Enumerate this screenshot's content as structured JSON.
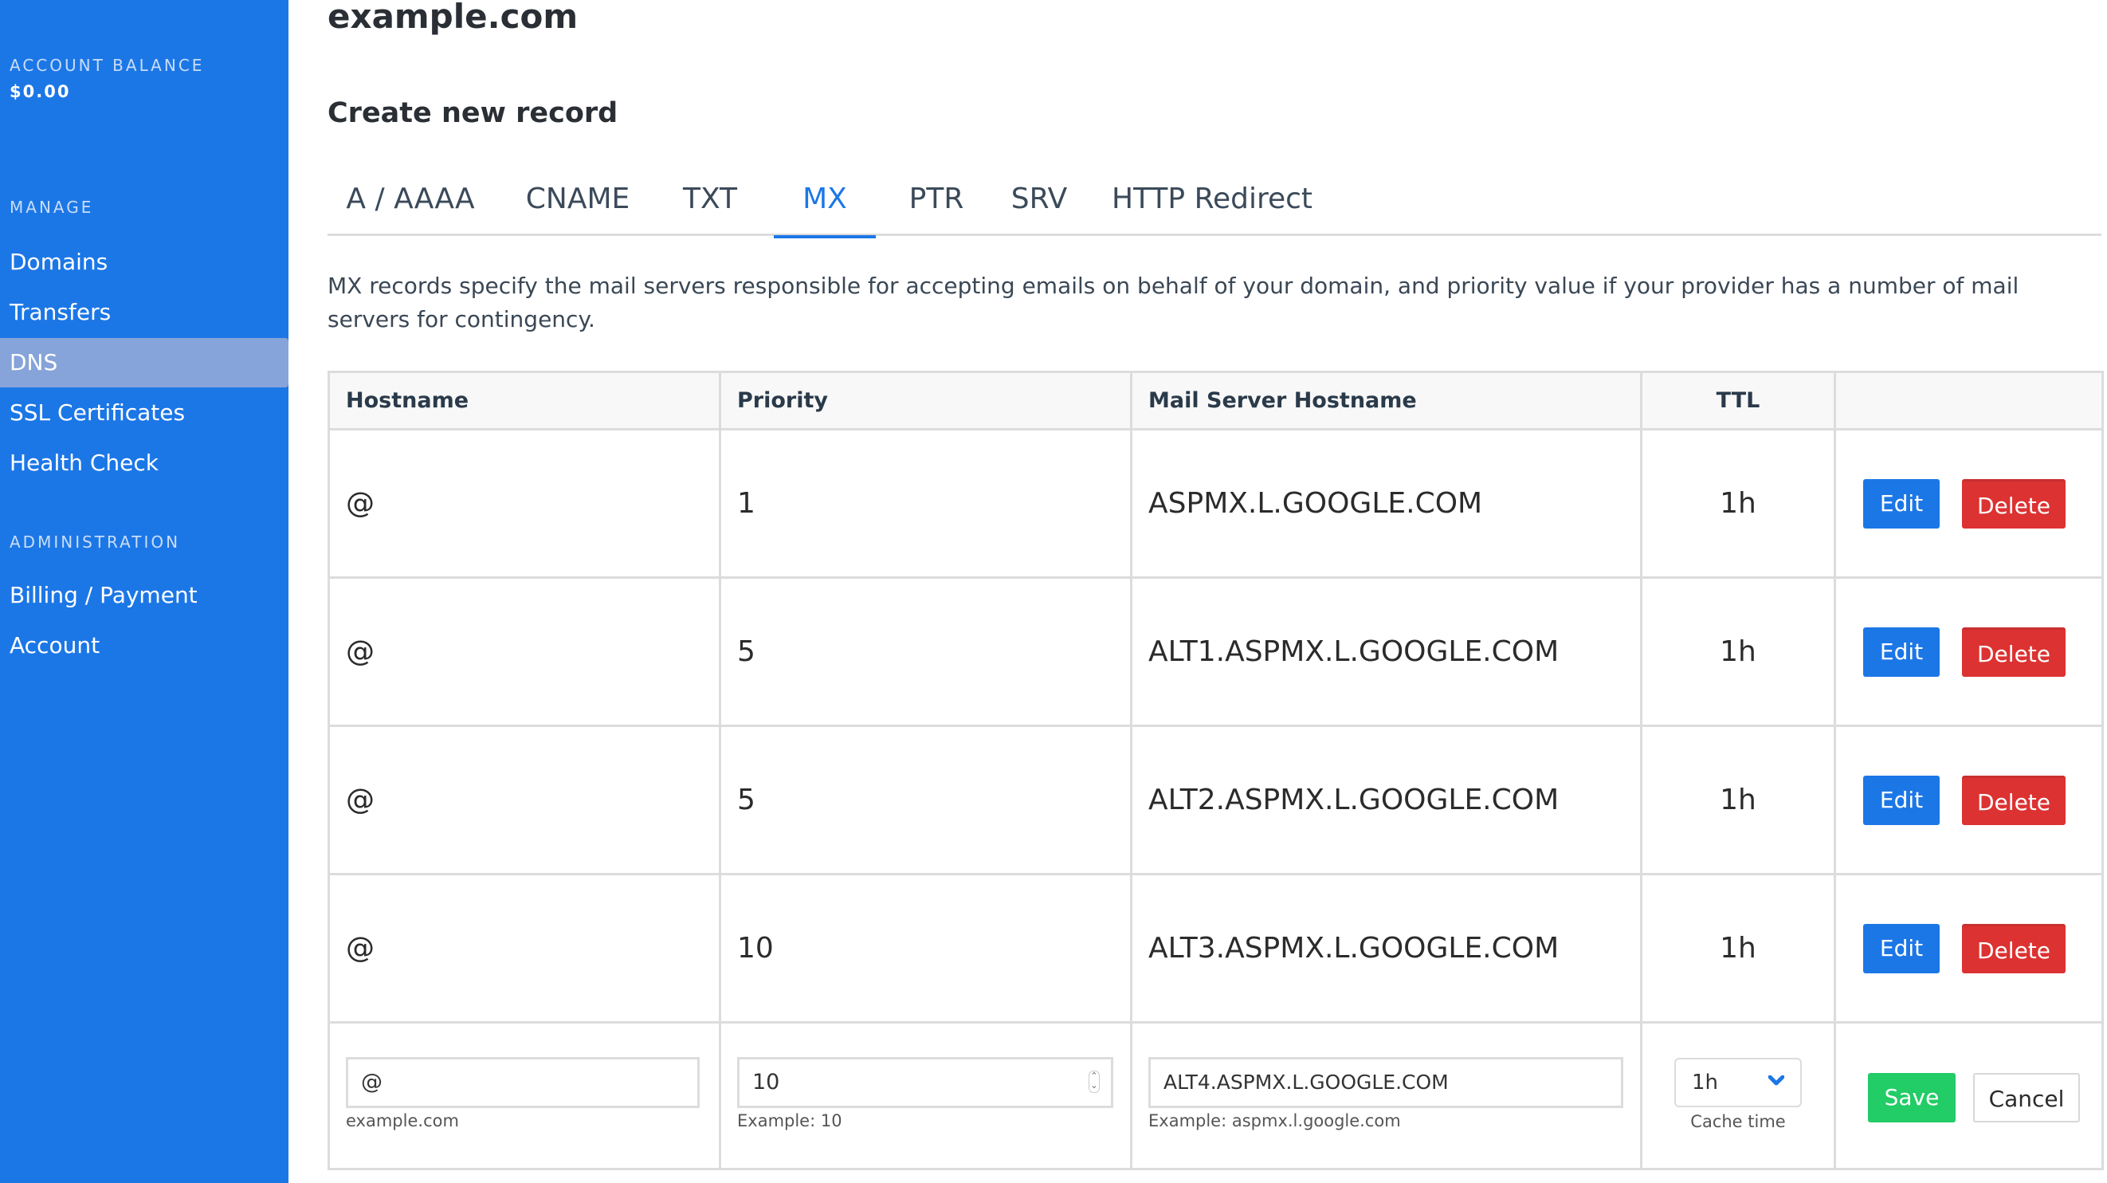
{
  "sidebar": {
    "balance_caption": "ACCOUNT BALANCE",
    "balance_value": "$0.00",
    "manage_caption": "MANAGE",
    "manage_items": [
      {
        "label": "Domains",
        "active": false
      },
      {
        "label": "Transfers",
        "active": false
      },
      {
        "label": "DNS",
        "active": true
      },
      {
        "label": "SSL Certificates",
        "active": false
      },
      {
        "label": "Health Check",
        "active": false
      }
    ],
    "admin_caption": "ADMINISTRATION",
    "admin_items": [
      {
        "label": "Billing / Payment"
      },
      {
        "label": "Account"
      }
    ]
  },
  "main": {
    "title": "example.com",
    "section_title": "Create new record",
    "tabs": [
      {
        "label": "A / AAAA",
        "active": false
      },
      {
        "label": "CNAME",
        "active": false
      },
      {
        "label": "TXT",
        "active": false
      },
      {
        "label": "MX",
        "active": true
      },
      {
        "label": "PTR",
        "active": false
      },
      {
        "label": "SRV",
        "active": false
      },
      {
        "label": "HTTP Redirect",
        "active": false
      }
    ],
    "description": "MX records specify the mail servers responsible for accepting emails on behalf of your domain, and priority value if your provider has a number of mail servers for contingency."
  },
  "table": {
    "headers": {
      "hostname": "Hostname",
      "priority": "Priority",
      "mail_server": "Mail Server Hostname",
      "ttl": "TTL",
      "actions": ""
    },
    "rows": [
      {
        "hostname": "@",
        "priority": "1",
        "mail_server": "ASPMX.L.GOOGLE.COM",
        "ttl": "1h"
      },
      {
        "hostname": "@",
        "priority": "5",
        "mail_server": "ALT1.ASPMX.L.GOOGLE.COM",
        "ttl": "1h"
      },
      {
        "hostname": "@",
        "priority": "5",
        "mail_server": "ALT2.ASPMX.L.GOOGLE.COM",
        "ttl": "1h"
      },
      {
        "hostname": "@",
        "priority": "10",
        "mail_server": "ALT3.ASPMX.L.GOOGLE.COM",
        "ttl": "1h"
      }
    ],
    "edit_label": "Edit",
    "delete_label": "Delete"
  },
  "form": {
    "hostname_value": "@",
    "hostname_hint": "example.com",
    "priority_value": "10",
    "priority_hint": "Example: 10",
    "mail_value": "ALT4.ASPMX.L.GOOGLE.COM",
    "mail_hint": "Example: aspmx.l.google.com",
    "ttl_selected": "1h",
    "ttl_hint": "Cache time",
    "save_label": "Save",
    "cancel_label": "Cancel"
  },
  "colors": {
    "brand_blue": "#1c77e6",
    "sidebar_active": "#86a4d9",
    "delete_red": "#dc3232",
    "save_green": "#22cc66"
  }
}
